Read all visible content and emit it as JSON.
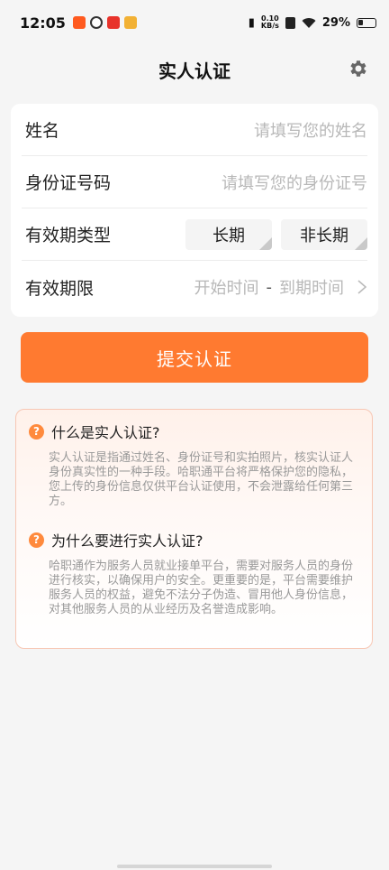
{
  "status": {
    "time": "12:05",
    "net_speed_value": "0.10",
    "net_speed_unit": "KB/s",
    "battery": "29%"
  },
  "header": {
    "title": "实人认证",
    "settings_icon": "gear-icon"
  },
  "form": {
    "name": {
      "label": "姓名",
      "placeholder": "请填写您的姓名"
    },
    "id_number": {
      "label": "身份证号码",
      "placeholder": "请填写您的身份证号"
    },
    "validity_type": {
      "label": "有效期类型",
      "options": [
        "长期",
        "非长期"
      ]
    },
    "validity_range": {
      "label": "有效期限",
      "start": "开始时间",
      "separator": "-",
      "end": "到期时间"
    }
  },
  "submit_label": "提交认证",
  "info": [
    {
      "question": "什么是实人认证?",
      "answer": "实人认证是指通过姓名、身份证号和实拍照片，核实认证人身份真实性的一种手段。哈职通平台将严格保护您的隐私，您上传的身份信息仅供平台认证使用，不会泄露给任何第三方。"
    },
    {
      "question": "为什么要进行实人认证?",
      "answer": "哈职通作为服务人员就业接单平台，需要对服务人员的身份进行核实，以确保用户的安全。更重要的是，平台需要维护服务人员的权益，避免不法分子伪造、冒用他人身份信息，对其他服务人员的从业经历及名誉造成影响。"
    }
  ],
  "colors": {
    "accent": "#ff7a30",
    "info_border": "#f7c7b4",
    "placeholder": "#b8b8b8"
  }
}
